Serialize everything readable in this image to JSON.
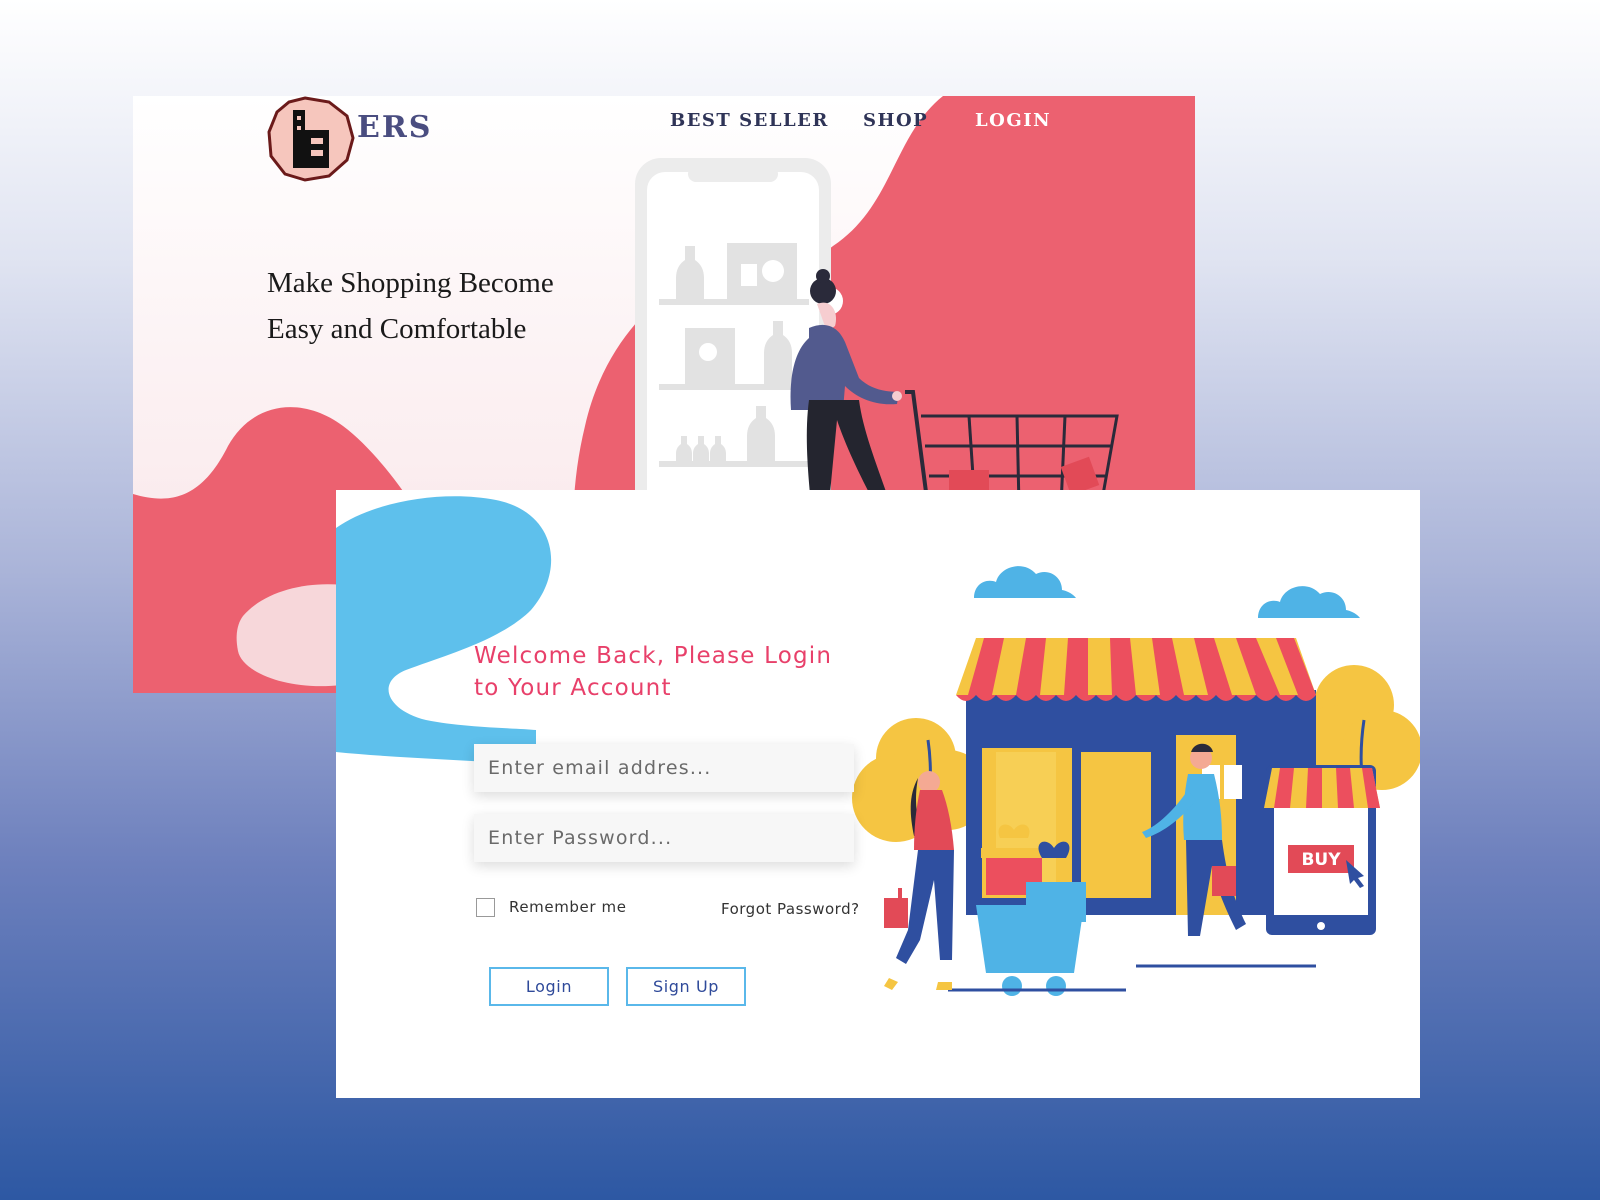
{
  "brand": {
    "logo_letter": "b",
    "name_suffix": "ERS"
  },
  "nav": {
    "best_seller": "BEST SELLER",
    "shop": "SHOP",
    "login": "LOGIN"
  },
  "hero": {
    "line1": "Make Shopping Become",
    "line2": "Easy and Comfortable"
  },
  "login_form": {
    "welcome_line1": "Welcome Back, Please Login",
    "welcome_line2": "to Your Account",
    "email_placeholder": "Enter email addres...",
    "password_placeholder": "Enter Password...",
    "remember_label": "Remember me",
    "forgot_label": "Forgot Password?",
    "login_button": "Login",
    "signup_button": "Sign Up"
  },
  "illustration": {
    "buy_sign": "BUY"
  },
  "colors": {
    "coral": "#ec6170",
    "sky_blue": "#5ec0ec",
    "navy": "#2f4fa0",
    "welcome_pink": "#e8406a",
    "awning_yellow": "#f5c542",
    "awning_red": "#ec4f5e"
  }
}
